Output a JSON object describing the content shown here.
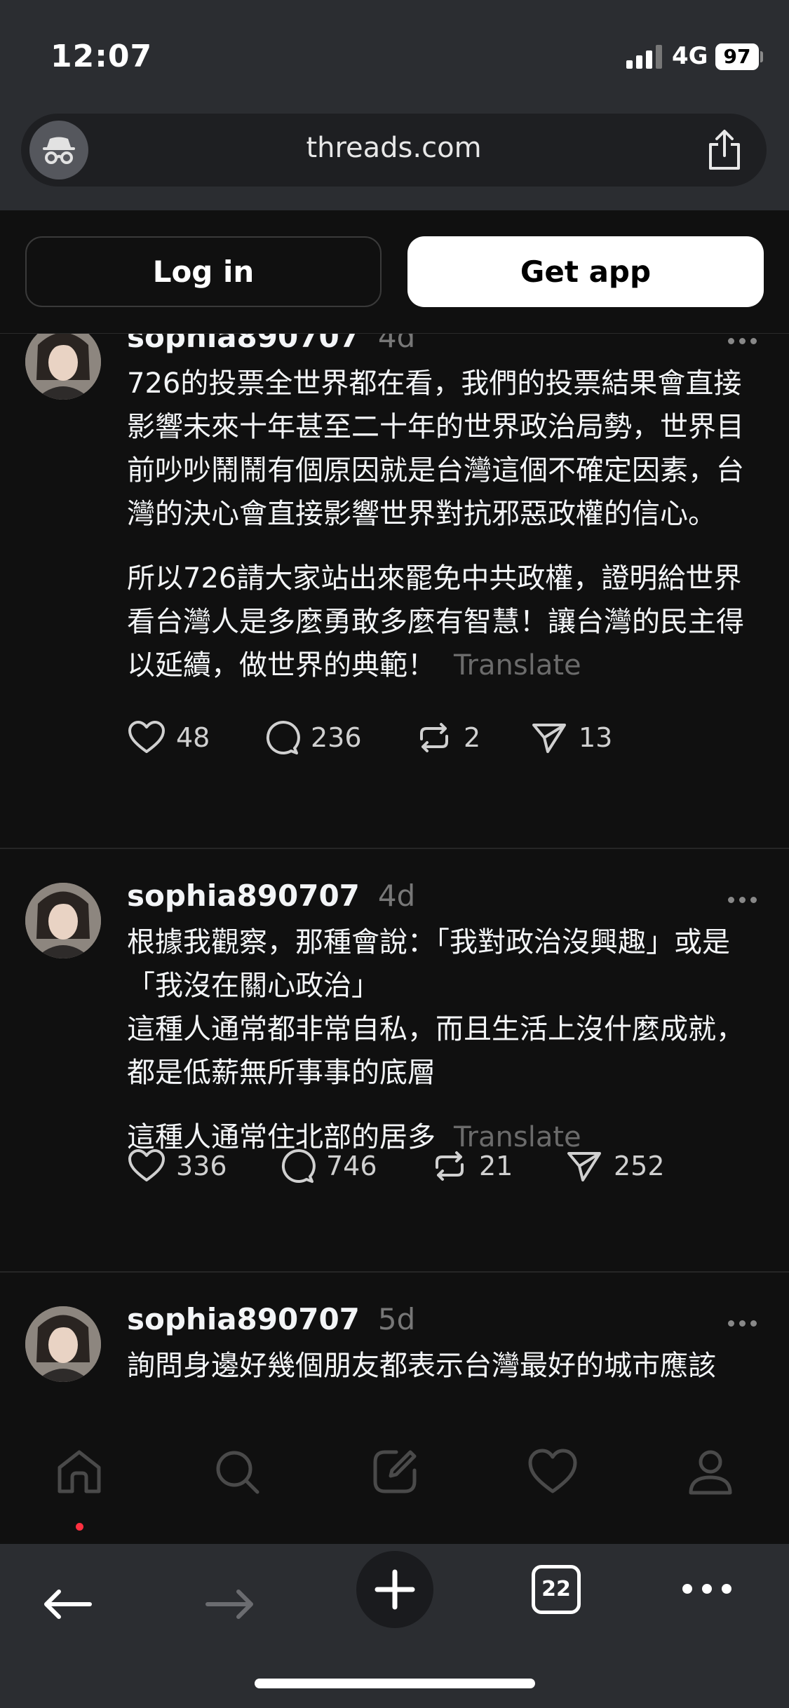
{
  "status": {
    "time": "12:07",
    "network": "4G",
    "battery": "97"
  },
  "browser": {
    "url": "threads.com",
    "tab_count": "22"
  },
  "auth": {
    "login_label": "Log in",
    "getapp_label": "Get app"
  },
  "posts": [
    {
      "username": "sophia890707",
      "age": "4d",
      "paragraphs": [
        "726的投票全世界都在看，我們的投票結果會直接影響未來十年甚至二十年的世界政治局勢，世界目前吵吵鬧鬧有個原因就是台灣這個不確定因素，台灣的決心會直接影響世界對抗邪惡政權的信心。",
        "所以726請大家站出來罷免中共政權，證明給世界看台灣人是多麼勇敢多麼有智慧！讓台灣的民主得以延續，做世界的典範！"
      ],
      "translate": "Translate",
      "likes": "48",
      "replies": "236",
      "reposts": "2",
      "shares": "13"
    },
    {
      "username": "sophia890707",
      "age": "4d",
      "paragraphs": [
        "根據我觀察，那種會說：「我對政治沒興趣」或是「我沒在關心政治」",
        "這種人通常都非常自私，而且生活上沒什麼成就，都是低薪無所事事的底層",
        "這種人通常住北部的居多"
      ],
      "translate": "Translate",
      "likes": "336",
      "replies": "746",
      "reposts": "21",
      "shares": "252"
    },
    {
      "username": "sophia890707",
      "age": "5d",
      "paragraphs": [
        "詢問身邊好幾個朋友都表示台灣最好的城市應該"
      ]
    }
  ],
  "icons": {
    "like": "heart-icon",
    "reply": "comment-icon",
    "repost": "repost-icon",
    "share": "send-icon",
    "nav": [
      "home-icon",
      "search-icon",
      "compose-icon",
      "heart-icon",
      "profile-icon"
    ],
    "toolbar": [
      "back-icon",
      "forward-icon",
      "new-tab-icon",
      "tabs-icon",
      "more-icon"
    ]
  }
}
